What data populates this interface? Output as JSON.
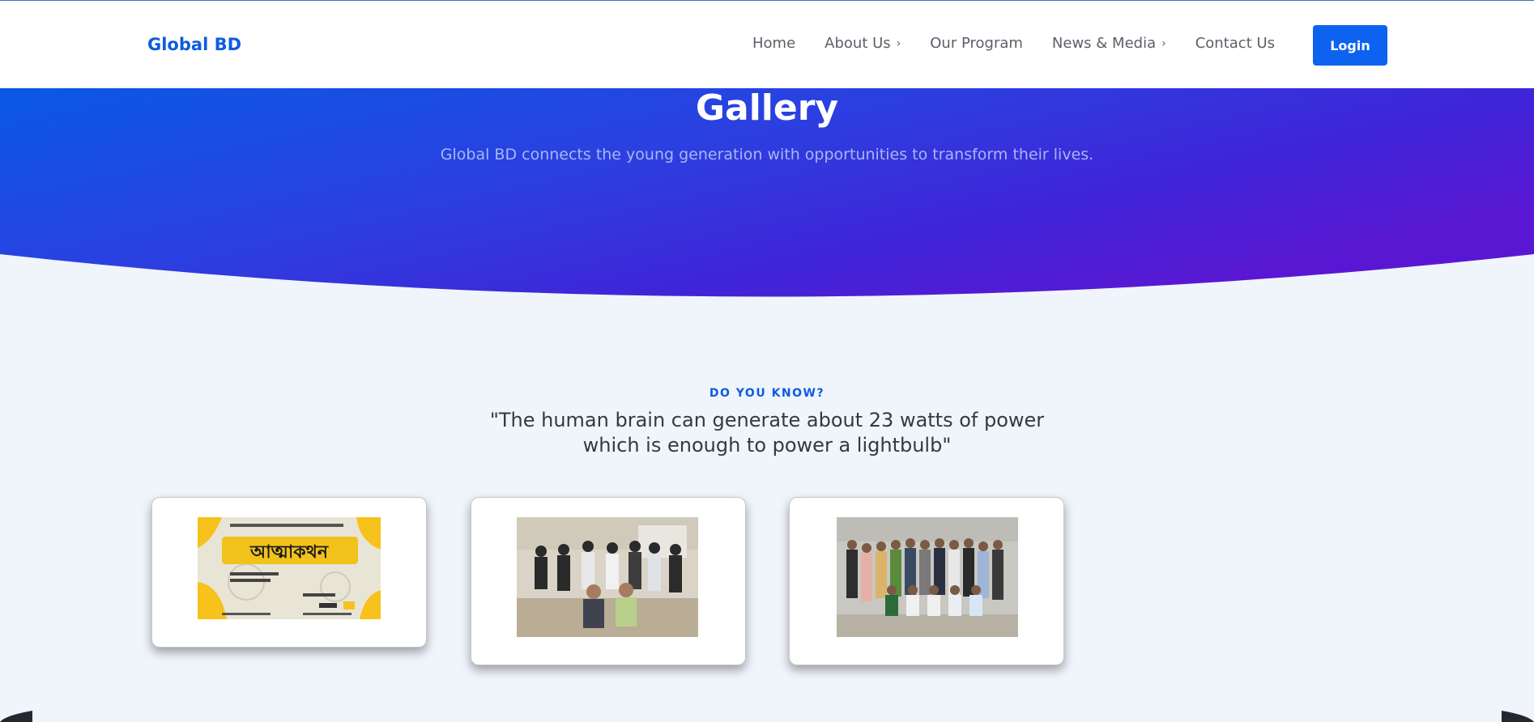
{
  "brand": "Global BD",
  "nav": {
    "home": "Home",
    "about": "About Us",
    "program": "Our Program",
    "news": "News & Media",
    "contact": "Contact Us"
  },
  "login_label": "Login",
  "hero": {
    "title": "Gallery",
    "subtitle": "Global BD connects the young generation with opportunities to transform their lives."
  },
  "section": {
    "eyebrow": "DO YOU KNOW?",
    "quote": "\"The human brain can generate about 23 watts of power which is enough to power a lightbulb\""
  },
  "gallery": [
    {
      "caption_text": "আত্মাকথন"
    },
    {},
    {}
  ],
  "colors": {
    "brand": "#0d5ce0",
    "hero_start": "#0a59e6",
    "hero_end": "#5a17d3",
    "login_bg": "#0d63f0",
    "page_bg": "#f0f4fb"
  },
  "icons": {
    "dropdown": "chevron-right-icon"
  }
}
